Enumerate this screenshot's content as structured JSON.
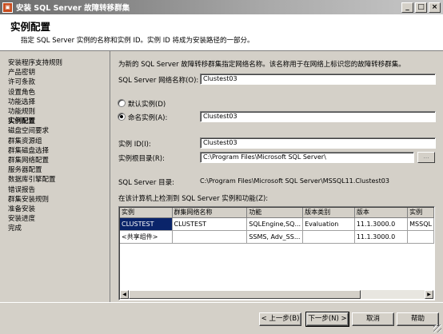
{
  "window": {
    "title": "安装 SQL Server 故障转移群集",
    "app_icon": "sql-setup-icon"
  },
  "header": {
    "title": "实例配置",
    "description": "指定 SQL Server 实例的名称和实例 ID。实例 ID 将成为安装路径的一部分。"
  },
  "nav": {
    "items": [
      "安装程序支持规则",
      "产品密钥",
      "许可条款",
      "设置角色",
      "功能选择",
      "功能规则",
      "实例配置",
      "磁盘空间要求",
      "群集资源组",
      "群集磁盘选择",
      "群集网络配置",
      "服务器配置",
      "数据库引擎配置",
      "错误报告",
      "群集安装规则",
      "准备安装",
      "安装进度",
      "完成"
    ],
    "active_index": 6
  },
  "form": {
    "intro": "为新的 SQL Server 故障转移群集指定网络名称。该名称用于在网络上标识您的故障转移群集。",
    "network_name_label": "SQL Server 网络名称(O):",
    "network_name_value": "Clustest03",
    "default_instance_label": "默认实例(D)",
    "named_instance_label": "命名实例(A):",
    "named_instance_value": "Clustest03",
    "instance_id_label": "实例 ID(I):",
    "instance_id_value": "Clustest03",
    "instance_root_label": "实例根目录(R):",
    "instance_root_value": "C:\\Program Files\\Microsoft SQL Server\\",
    "browse_label": "...",
    "sql_dir_label": "SQL Server 目录:",
    "sql_dir_value": "C:\\Program Files\\Microsoft SQL Server\\MSSQL11.Clustest03",
    "detected_label": "在该计算机上检测到 SQL Server 实例和功能(Z):"
  },
  "table": {
    "columns": [
      "实例",
      "群集网络名称",
      "功能",
      "版本类别",
      "版本",
      "实例"
    ],
    "rows": [
      [
        "CLUSTEST",
        "CLUSTEST",
        "SQLEngine,SQ...",
        "Evaluation",
        "11.1.3000.0",
        "MSSQL"
      ],
      [
        "<共享组件>",
        "",
        "SSMS, Adv_SS...",
        "",
        "11.1.3000.0",
        ""
      ]
    ]
  },
  "footer": {
    "back": "< 上一步(B)",
    "next": "下一步(N) >",
    "cancel": "取消",
    "help": "帮助"
  }
}
